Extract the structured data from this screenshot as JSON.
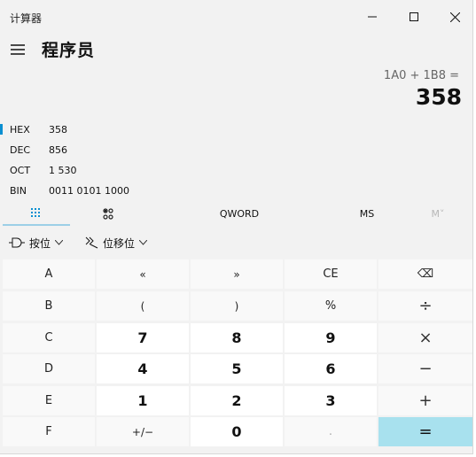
{
  "window": {
    "title": "计算器"
  },
  "header": {
    "mode": "程序员"
  },
  "display": {
    "expression": "1A0 + 1B8 =",
    "result": "358"
  },
  "radix": [
    {
      "label": "HEX",
      "value": "358",
      "active": true
    },
    {
      "label": "DEC",
      "value": "856",
      "active": false
    },
    {
      "label": "OCT",
      "value": "1 530",
      "active": false
    },
    {
      "label": "BIN",
      "value": "0011 0101 1000",
      "active": false
    }
  ],
  "toolbar": {
    "keypad_icon": "full-keypad-icon",
    "bit_toggle_icon": "bit-toggle-keypad-icon",
    "word_size": "QWORD",
    "ms": "MS",
    "mv": "M˅"
  },
  "bitwise": {
    "bitwise_label": "按位",
    "shift_label": "位移位"
  },
  "keys": [
    [
      "A",
      "«",
      "»",
      "CE",
      "⌫"
    ],
    [
      "B",
      "(",
      ")",
      "%",
      "÷"
    ],
    [
      "C",
      "7",
      "8",
      "9",
      "×"
    ],
    [
      "D",
      "4",
      "5",
      "6",
      "−"
    ],
    [
      "E",
      "1",
      "2",
      "3",
      "+"
    ],
    [
      "F",
      "+/−",
      "0",
      ".",
      "="
    ]
  ],
  "colors": {
    "accent_indicator": "#0a8fd1",
    "equals_bg": "#a8e1ee",
    "window_bg": "#f2f2f2"
  }
}
